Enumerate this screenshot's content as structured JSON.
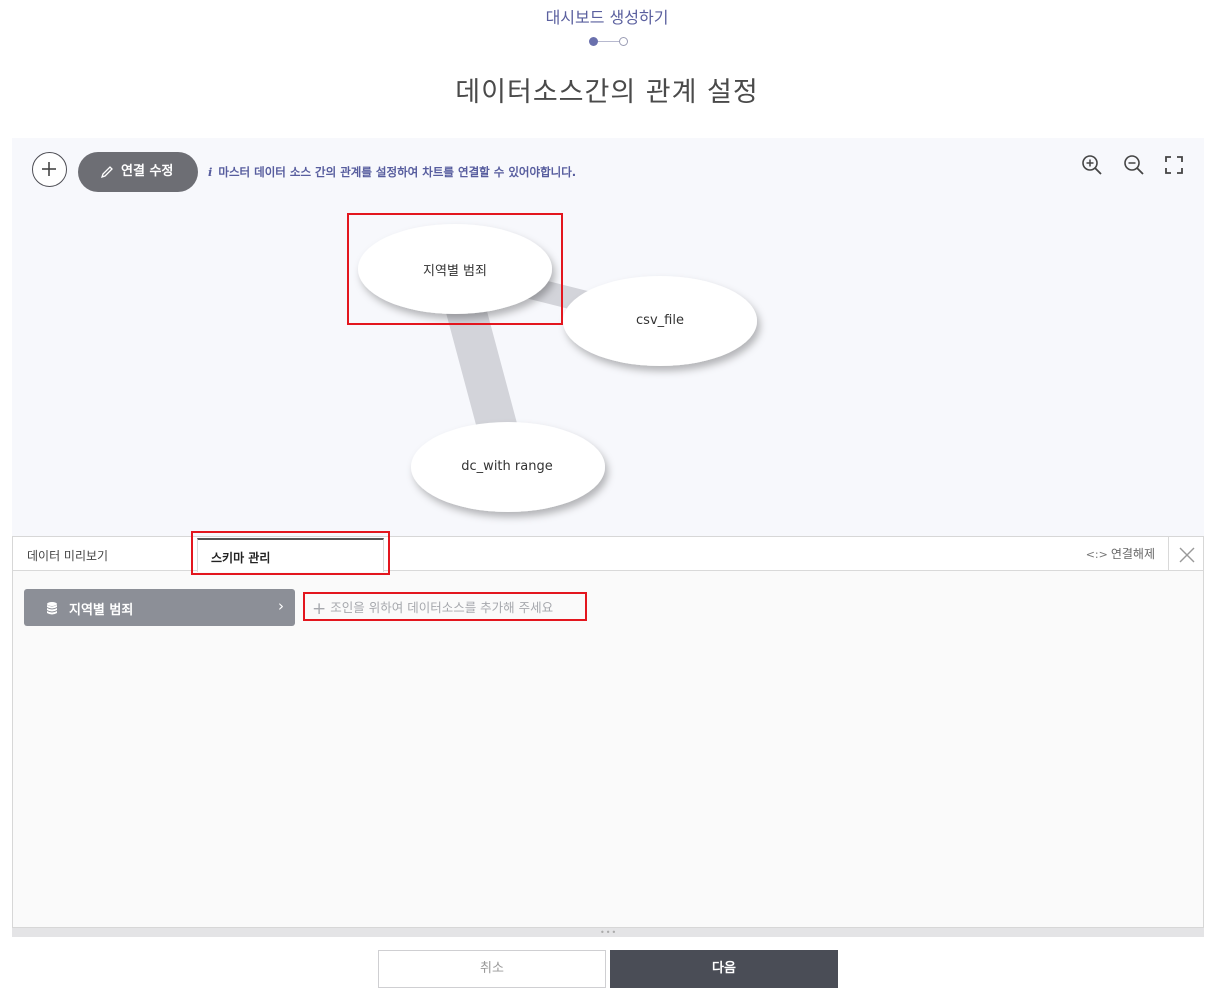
{
  "header": {
    "wizard_title": "대시보드 생성하기",
    "step_current": 1,
    "step_total": 2,
    "page_heading": "데이터소스간의 관계 설정"
  },
  "canvas": {
    "edit_link_label": "연결 수정",
    "info_text": "마스터 데이터 소스 간의 관계를 설정하여 차트를 연결할 수 있어야합니다.",
    "nodes": [
      {
        "label": "지역별 범죄"
      },
      {
        "label": "csv_file"
      },
      {
        "label": "dc_with range"
      }
    ],
    "icons": {
      "add": "plus-circle-icon",
      "edit": "pencil-icon",
      "info": "info-icon",
      "zoom_in": "zoom-in-icon",
      "zoom_out": "zoom-out-icon",
      "fit": "fullscreen-icon"
    }
  },
  "panel": {
    "tabs": [
      {
        "label": "데이터 미리보기",
        "active": false
      },
      {
        "label": "스키마 관리",
        "active": true
      }
    ],
    "unlink_label": "연결해제",
    "datasource_chip_label": "지역별 범죄",
    "chip_chevron": "›",
    "add_join_label": "조인을 위하여 데이터소스를 추가해 주세요"
  },
  "footer": {
    "cancel_label": "취소",
    "next_label": "다음"
  },
  "colors": {
    "accent": "#5a5f9e",
    "primary_button": "#4a4d56",
    "highlight_box": "#e3161e",
    "canvas_bg": "#f7f8fc"
  }
}
